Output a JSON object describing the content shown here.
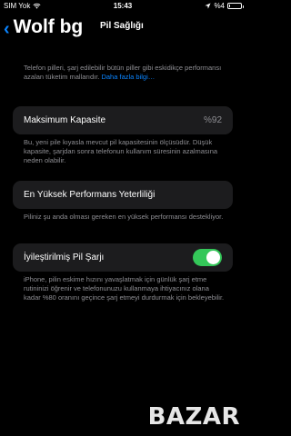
{
  "status_bar": {
    "carrier": "SIM Yok",
    "time": "15:43",
    "battery_percent": "%4",
    "icons": [
      "wifi-icon",
      "location-icon",
      "battery-icon"
    ]
  },
  "nav": {
    "back_label": "Wolf bg",
    "title": "Pil Sağlığı"
  },
  "intro": {
    "text": "Telefon pilleri, şarj edilebilir bütün piller gibi eskidikçe performansı azalan tüketim mallarıdır.",
    "link": "Daha fazla bilgi…"
  },
  "max_capacity": {
    "label": "Maksimum Kapasite",
    "value": "%92",
    "footnote": "Bu, yeni pile kıyasla mevcut pil kapasitesinin ölçüsüdür. Düşük kapasite, şarjdan sonra telefonun kullanım süresinin azalmasına neden olabilir."
  },
  "peak_performance": {
    "label": "En Yüksek Performans Yeterliliği",
    "footnote": "Piliniz şu anda olması gereken en yüksek performansı destekliyor."
  },
  "optimized_charging": {
    "label": "İyileştirilmiş Pil Şarjı",
    "enabled": true,
    "footnote": "iPhone, pilin eskime hızını yavaşlatmak için günlük şarj etme rutininizi öğrenir ve telefonunuzu kullanmaya ihtiyacınız olana kadar %80 oranını geçince şarj etmeyi durdurmak için bekleyebilir."
  },
  "watermark": "BAZAR",
  "colors": {
    "background": "#000000",
    "cell": "#1c1c1e",
    "accent": "#0a84ff",
    "toggle_on": "#34c759",
    "secondary_text": "#8e8e93"
  }
}
